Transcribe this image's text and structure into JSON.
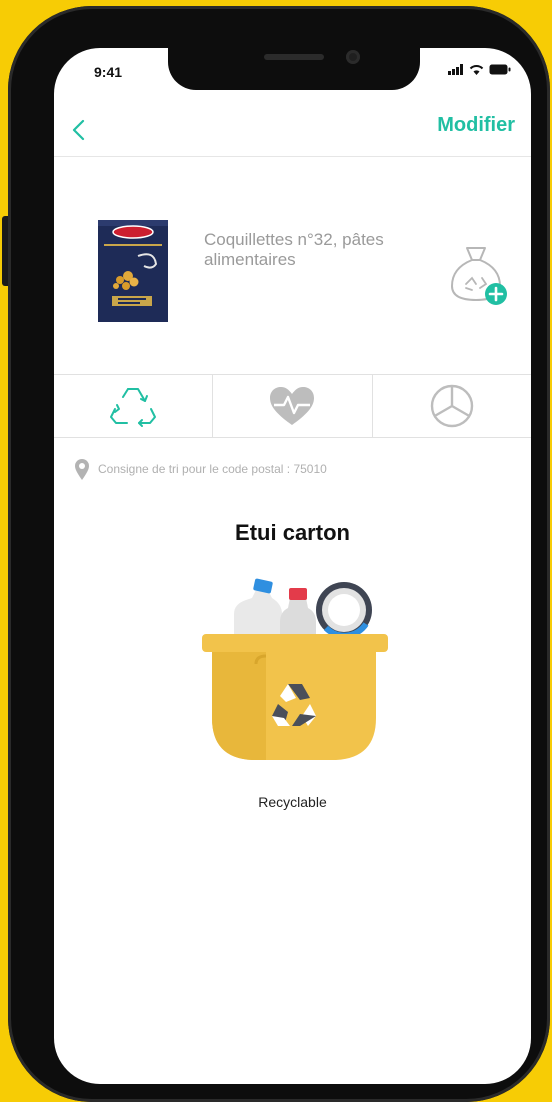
{
  "status_bar": {
    "time": "9:41"
  },
  "nav": {
    "edit_label": "Modifier"
  },
  "product": {
    "name": "Coquillettes n°32, pâtes alimentaires"
  },
  "tabs": [
    {
      "icon": "recycle-icon"
    },
    {
      "icon": "heart-pulse-icon"
    },
    {
      "icon": "mercedes-logo-icon"
    }
  ],
  "sorting": {
    "postal_instruction": "Consigne de tri pour le code postal : 75010"
  },
  "item": {
    "title": "Etui carton",
    "status": "Recyclable"
  },
  "colors": {
    "accent": "#21BFA3",
    "background": "#F7CC05",
    "bin": "#F2C34B"
  }
}
